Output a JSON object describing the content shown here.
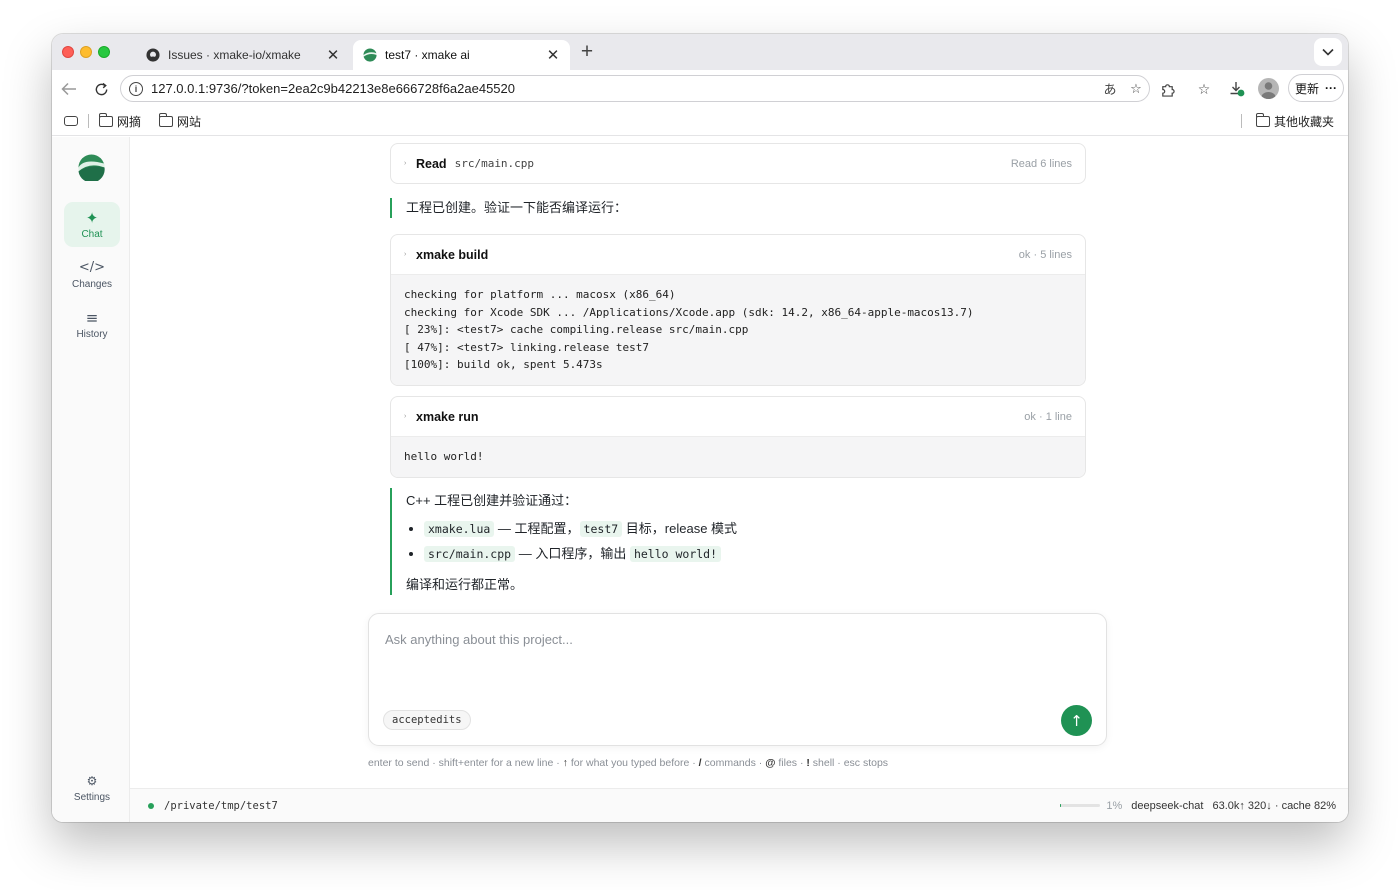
{
  "browser": {
    "tabs": [
      {
        "title": "Issues · xmake-io/xmake",
        "close": "✕",
        "icon": "github-icon"
      },
      {
        "title": "test7 · xmake ai",
        "close": "✕",
        "icon": "xmake-logo-icon"
      }
    ],
    "new_tab": "+",
    "url": "127.0.0.1:9736/?token=2ea2c9b42213e8e666728f6a2ae45520",
    "update_label": "更新",
    "more": "···",
    "bookmarks": [
      "网摘",
      "网站"
    ],
    "other_bookmarks": "其他收藏夹"
  },
  "sidebar": {
    "items": [
      {
        "icon": "✦",
        "label": "Chat"
      },
      {
        "icon": "</>",
        "label": "Changes"
      },
      {
        "icon": "≡",
        "label": "History"
      }
    ],
    "settings": {
      "icon": "⚙",
      "label": "Settings"
    }
  },
  "conversation": {
    "read_card": {
      "tool": "Read",
      "path": "src/main.cpp",
      "meta": "Read 6 lines",
      "caret": "›"
    },
    "msg1": "工程已创建。验证一下能否编译运行：",
    "build_card": {
      "tool": "xmake build",
      "meta": "ok · 5 lines",
      "caret": "›",
      "output": "checking for platform ... macosx (x86_64)\nchecking for Xcode SDK ... /Applications/Xcode.app (sdk: 14.2, x86_64-apple-macos13.7)\n[ 23%]: <test7> cache compiling.release src/main.cpp\n[ 47%]: <test7> linking.release test7\n[100%]: build ok, spent 5.473s"
    },
    "run_card": {
      "tool": "xmake run",
      "meta": "ok · 1 line",
      "caret": "›",
      "output": "hello world!"
    },
    "summary": {
      "intro": "C++ 工程已创建并验证通过：",
      "item1_code": "xmake.lua",
      "item1_text1": " — 工程配置，",
      "item1_code2": "test7",
      "item1_text2": " 目标，release 模式",
      "item2_code": "src/main.cpp",
      "item2_text1": " — 入口程序，输出 ",
      "item2_code2": "hello world!",
      "outro": "编译和运行都正常。"
    }
  },
  "composer": {
    "placeholder": "Ask anything about this project...",
    "mode": "acceptedits",
    "send": "↑"
  },
  "hints": {
    "p1": "enter to send · shift+enter for a new line · ",
    "k1": "↑",
    "p2": " for what you typed before · ",
    "k2": "/",
    "p3": " commands · ",
    "k3": "@",
    "p4": " files · ",
    "k4": "!",
    "p5": " shell · esc stops"
  },
  "status": {
    "path": "/private/tmp/test7",
    "context_percent": "1%",
    "context_fraction": 0.01,
    "model": "deepseek-chat",
    "tokens": "63.0k↑ 320↓ · cache 82%",
    "dot_color": "#27a05a"
  },
  "colors": {
    "accent": "#1f9254",
    "accent_bg": "#e6f4ec"
  }
}
